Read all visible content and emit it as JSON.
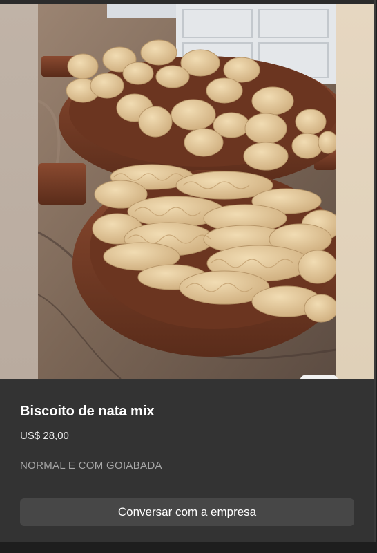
{
  "product": {
    "title": "Biscoito de nata mix",
    "price": "US$ 28,00",
    "description": "NORMAL E COM GOIABADA",
    "chat_label": "Conversar com a empresa"
  },
  "colors": {
    "panel_background": "#333333",
    "button_background": "#474747",
    "title_text": "#ffffff",
    "description_text": "#a8a8a8"
  }
}
